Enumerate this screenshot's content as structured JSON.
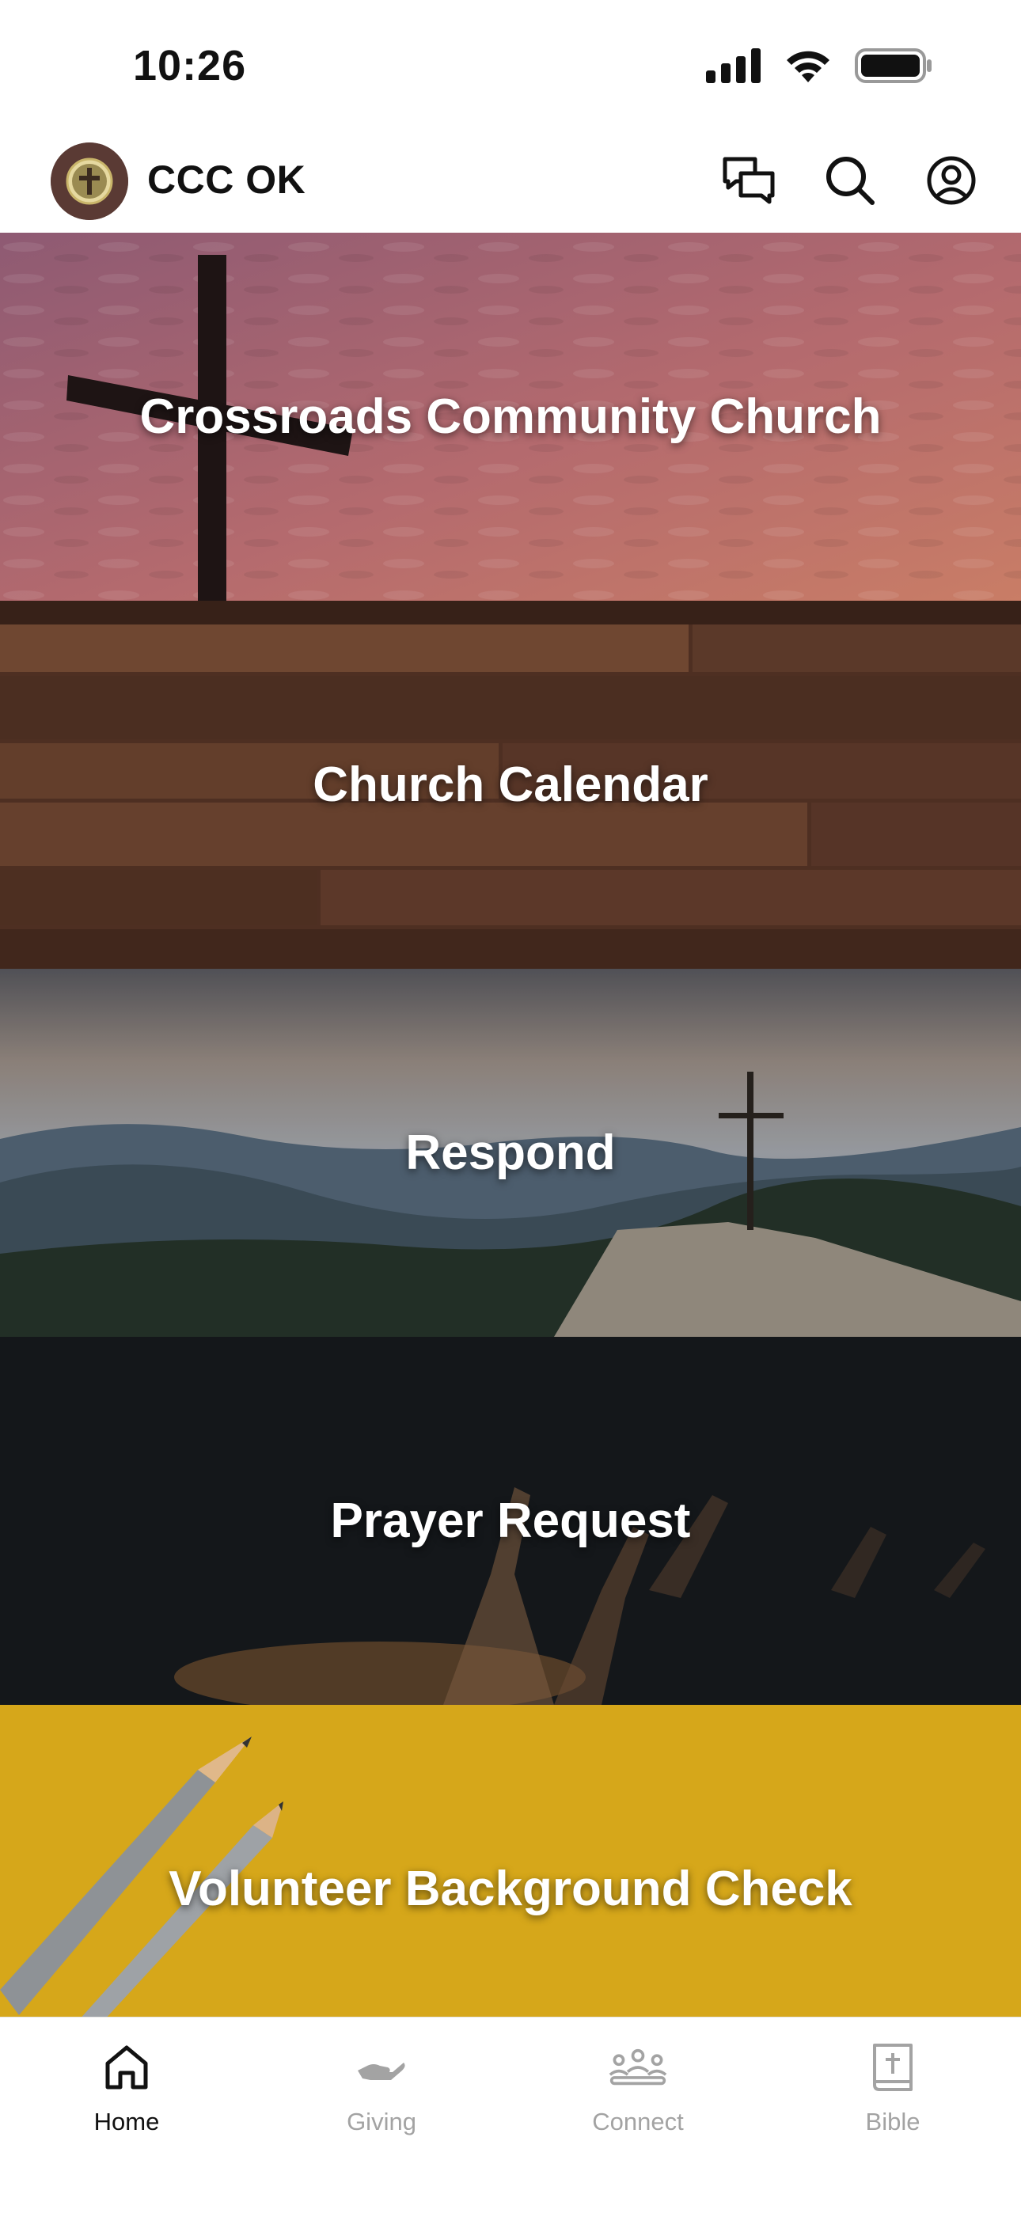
{
  "status_bar": {
    "time": "10:26",
    "icons": [
      "signal-icon",
      "wifi-icon",
      "battery-icon"
    ]
  },
  "header": {
    "title": "CCC OK",
    "actions": [
      "chat-icon",
      "search-icon",
      "profile-icon"
    ]
  },
  "tiles": [
    {
      "label": "Crossroads Community Church",
      "scene": "cross-pink-sky"
    },
    {
      "label": "Church Calendar",
      "scene": "wood-planks"
    },
    {
      "label": "Respond",
      "scene": "mountain-cross"
    },
    {
      "label": "Prayer Request",
      "scene": "raised-hands-dark"
    },
    {
      "label": "Volunteer Background Check",
      "scene": "pencils-yellow"
    }
  ],
  "bottom_nav": {
    "items": [
      {
        "label": "Home",
        "icon": "home-icon",
        "active": true
      },
      {
        "label": "Giving",
        "icon": "giving-hand-icon",
        "active": false
      },
      {
        "label": "Connect",
        "icon": "people-group-icon",
        "active": false
      },
      {
        "label": "Bible",
        "icon": "bible-icon",
        "active": false
      }
    ]
  },
  "colors": {
    "active_nav": "#111111",
    "inactive_nav": "#a3a3a3",
    "tile_text": "#ffffff",
    "yellow_tile": "#d6a71a"
  }
}
